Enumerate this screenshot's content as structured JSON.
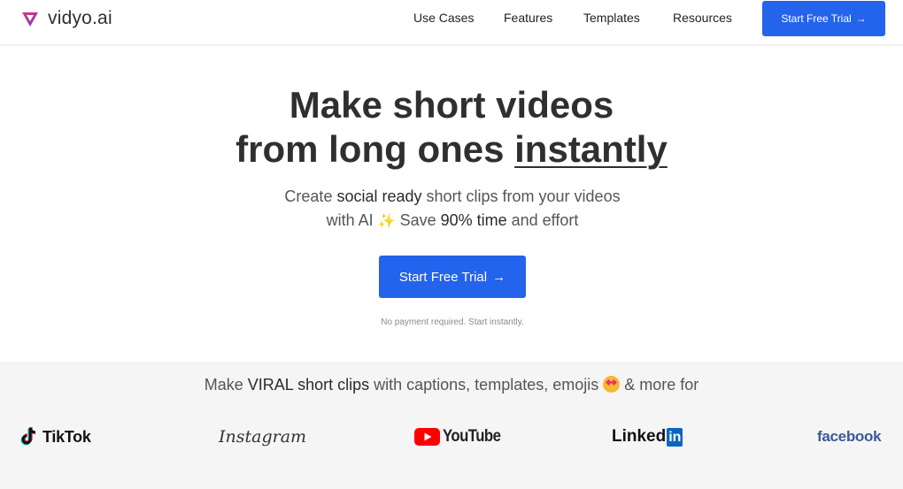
{
  "nav": {
    "logo_text": "vidyo.ai",
    "links": [
      "Use Cases",
      "Features",
      "Templates",
      "Resources"
    ],
    "cta_label": "Start Free Trial",
    "cta_arrow": "→"
  },
  "hero": {
    "title_line1": "Make short videos",
    "title_line2_pre": "from long ones ",
    "title_line2_underlined": "instantly",
    "sub_part1": "Create ",
    "sub_bold1": "social ready",
    "sub_part2": " short clips from your videos",
    "sub_part3": "with AI ",
    "sub_sparkle": "✨",
    "sub_part4": " Save ",
    "sub_bold2": "90% time",
    "sub_part5": " and effort",
    "cta_label": "Start Free Trial",
    "cta_arrow": "→",
    "note": "No payment required. Start instantly."
  },
  "band": {
    "text_pre": "Make ",
    "text_bold": "VIRAL short clips",
    "text_post": " with captions, templates, emojis ",
    "text_end": " & more for",
    "logos": {
      "tiktok": "TikTok",
      "instagram": "Instagram",
      "youtube": "YouTube",
      "linkedin_word": "Linked",
      "linkedin_box": "in",
      "facebook": "facebook"
    }
  },
  "colors": {
    "accent": "#2463eb",
    "logo_gradient": [
      "#e8336b",
      "#6b3fd8"
    ],
    "youtube_red": "#ff0000",
    "linkedin_blue": "#0a66c2",
    "facebook_blue": "#3b5998"
  }
}
